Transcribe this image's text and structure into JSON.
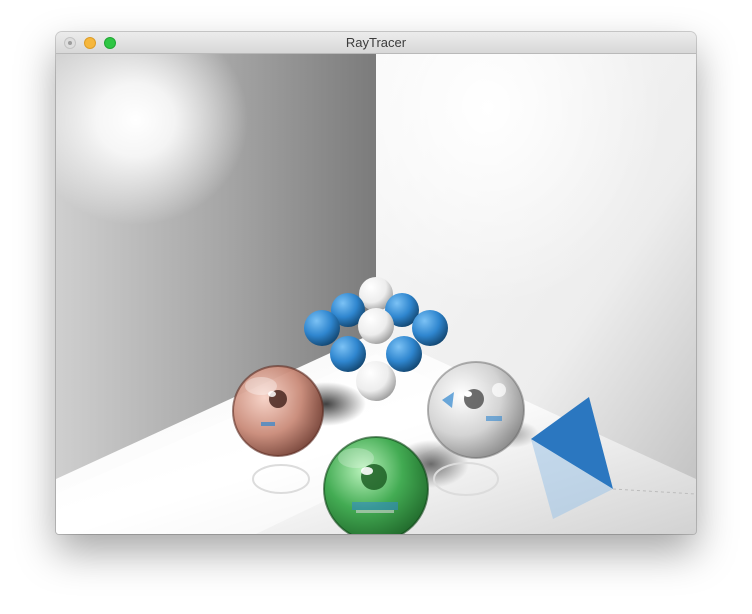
{
  "window": {
    "title": "RayTracer"
  },
  "controls": {
    "close_icon": "close-icon",
    "minimize_icon": "minimize-icon",
    "zoom_icon": "zoom-icon"
  },
  "scene": {
    "sphere_colors": {
      "copper": "#c98a78",
      "silver": "#cfcfcf",
      "green": "#3aa84b",
      "blue": "#2f86cf",
      "white": "#f2f2f2"
    },
    "triangle_color": "#2b77c0"
  }
}
